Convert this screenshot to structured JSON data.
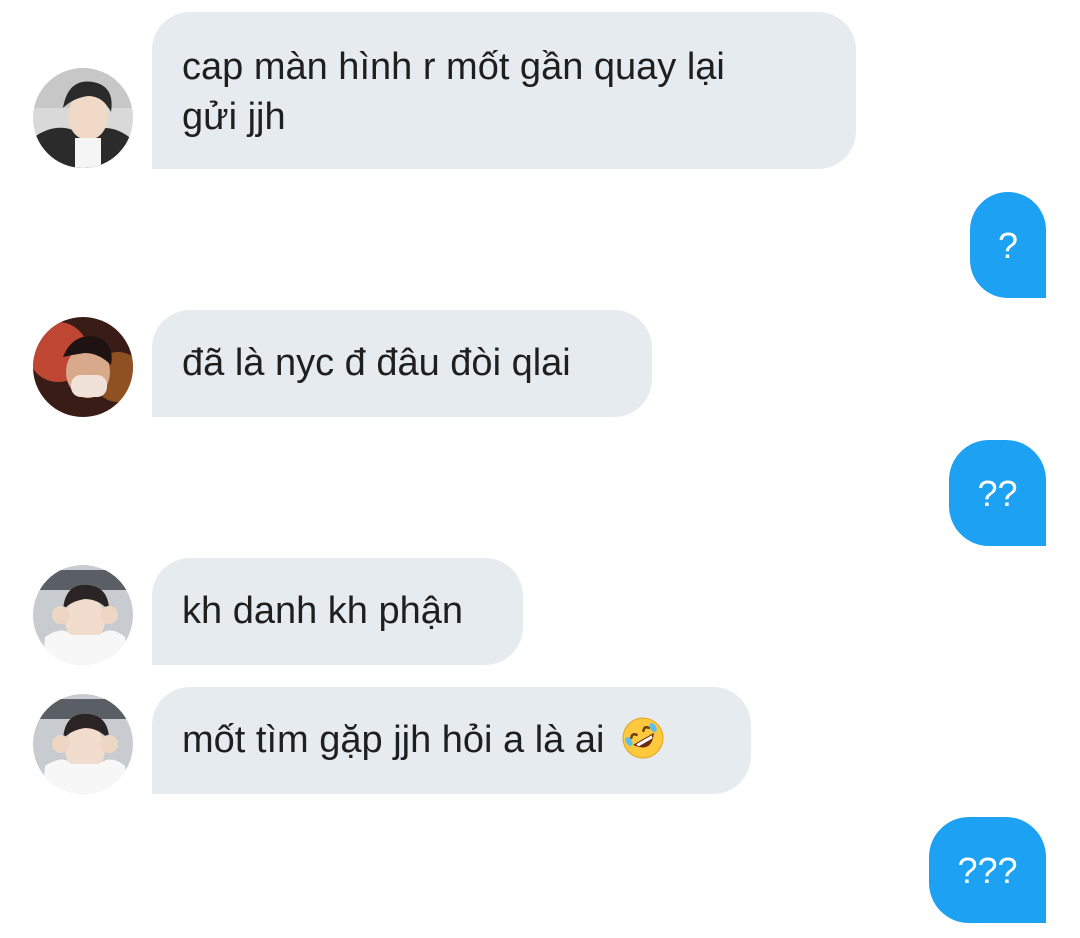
{
  "messages": [
    {
      "text_line1": "cap màn hình r mốt gần quay lại",
      "text_line2": "gửi jjh"
    },
    {
      "text": "?"
    },
    {
      "text": "đã là nyc đ đâu đòi qlai"
    },
    {
      "text": "??"
    },
    {
      "text": "kh danh kh phận"
    },
    {
      "text": "mốt tìm gặp jjh hỏi a là ai",
      "emoji": "rolling-on-floor-laughing-emoji"
    },
    {
      "text": "???"
    }
  ],
  "colors": {
    "incoming_bubble": "#e6ebf0",
    "outgoing_bubble": "#1da1f2",
    "incoming_text": "#1f1f1f",
    "outgoing_text": "#ffffff"
  }
}
